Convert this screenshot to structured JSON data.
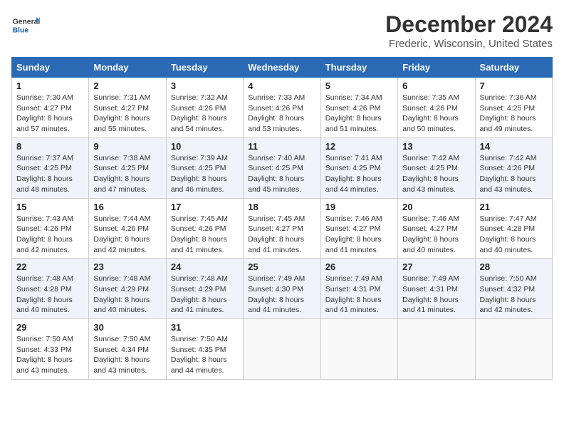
{
  "header": {
    "logo_general": "General",
    "logo_blue": "Blue",
    "title": "December 2024",
    "location": "Frederic, Wisconsin, United States"
  },
  "days_of_week": [
    "Sunday",
    "Monday",
    "Tuesday",
    "Wednesday",
    "Thursday",
    "Friday",
    "Saturday"
  ],
  "weeks": [
    [
      {
        "day": "1",
        "sunrise": "Sunrise: 7:30 AM",
        "sunset": "Sunset: 4:27 PM",
        "daylight": "Daylight: 8 hours and 57 minutes."
      },
      {
        "day": "2",
        "sunrise": "Sunrise: 7:31 AM",
        "sunset": "Sunset: 4:27 PM",
        "daylight": "Daylight: 8 hours and 55 minutes."
      },
      {
        "day": "3",
        "sunrise": "Sunrise: 7:32 AM",
        "sunset": "Sunset: 4:26 PM",
        "daylight": "Daylight: 8 hours and 54 minutes."
      },
      {
        "day": "4",
        "sunrise": "Sunrise: 7:33 AM",
        "sunset": "Sunset: 4:26 PM",
        "daylight": "Daylight: 8 hours and 53 minutes."
      },
      {
        "day": "5",
        "sunrise": "Sunrise: 7:34 AM",
        "sunset": "Sunset: 4:26 PM",
        "daylight": "Daylight: 8 hours and 51 minutes."
      },
      {
        "day": "6",
        "sunrise": "Sunrise: 7:35 AM",
        "sunset": "Sunset: 4:26 PM",
        "daylight": "Daylight: 8 hours and 50 minutes."
      },
      {
        "day": "7",
        "sunrise": "Sunrise: 7:36 AM",
        "sunset": "Sunset: 4:25 PM",
        "daylight": "Daylight: 8 hours and 49 minutes."
      }
    ],
    [
      {
        "day": "8",
        "sunrise": "Sunrise: 7:37 AM",
        "sunset": "Sunset: 4:25 PM",
        "daylight": "Daylight: 8 hours and 48 minutes."
      },
      {
        "day": "9",
        "sunrise": "Sunrise: 7:38 AM",
        "sunset": "Sunset: 4:25 PM",
        "daylight": "Daylight: 8 hours and 47 minutes."
      },
      {
        "day": "10",
        "sunrise": "Sunrise: 7:39 AM",
        "sunset": "Sunset: 4:25 PM",
        "daylight": "Daylight: 8 hours and 46 minutes."
      },
      {
        "day": "11",
        "sunrise": "Sunrise: 7:40 AM",
        "sunset": "Sunset: 4:25 PM",
        "daylight": "Daylight: 8 hours and 45 minutes."
      },
      {
        "day": "12",
        "sunrise": "Sunrise: 7:41 AM",
        "sunset": "Sunset: 4:25 PM",
        "daylight": "Daylight: 8 hours and 44 minutes."
      },
      {
        "day": "13",
        "sunrise": "Sunrise: 7:42 AM",
        "sunset": "Sunset: 4:25 PM",
        "daylight": "Daylight: 8 hours and 43 minutes."
      },
      {
        "day": "14",
        "sunrise": "Sunrise: 7:42 AM",
        "sunset": "Sunset: 4:26 PM",
        "daylight": "Daylight: 8 hours and 43 minutes."
      }
    ],
    [
      {
        "day": "15",
        "sunrise": "Sunrise: 7:43 AM",
        "sunset": "Sunset: 4:26 PM",
        "daylight": "Daylight: 8 hours and 42 minutes."
      },
      {
        "day": "16",
        "sunrise": "Sunrise: 7:44 AM",
        "sunset": "Sunset: 4:26 PM",
        "daylight": "Daylight: 8 hours and 42 minutes."
      },
      {
        "day": "17",
        "sunrise": "Sunrise: 7:45 AM",
        "sunset": "Sunset: 4:26 PM",
        "daylight": "Daylight: 8 hours and 41 minutes."
      },
      {
        "day": "18",
        "sunrise": "Sunrise: 7:45 AM",
        "sunset": "Sunset: 4:27 PM",
        "daylight": "Daylight: 8 hours and 41 minutes."
      },
      {
        "day": "19",
        "sunrise": "Sunrise: 7:46 AM",
        "sunset": "Sunset: 4:27 PM",
        "daylight": "Daylight: 8 hours and 41 minutes."
      },
      {
        "day": "20",
        "sunrise": "Sunrise: 7:46 AM",
        "sunset": "Sunset: 4:27 PM",
        "daylight": "Daylight: 8 hours and 40 minutes."
      },
      {
        "day": "21",
        "sunrise": "Sunrise: 7:47 AM",
        "sunset": "Sunset: 4:28 PM",
        "daylight": "Daylight: 8 hours and 40 minutes."
      }
    ],
    [
      {
        "day": "22",
        "sunrise": "Sunrise: 7:48 AM",
        "sunset": "Sunset: 4:28 PM",
        "daylight": "Daylight: 8 hours and 40 minutes."
      },
      {
        "day": "23",
        "sunrise": "Sunrise: 7:48 AM",
        "sunset": "Sunset: 4:29 PM",
        "daylight": "Daylight: 8 hours and 40 minutes."
      },
      {
        "day": "24",
        "sunrise": "Sunrise: 7:48 AM",
        "sunset": "Sunset: 4:29 PM",
        "daylight": "Daylight: 8 hours and 41 minutes."
      },
      {
        "day": "25",
        "sunrise": "Sunrise: 7:49 AM",
        "sunset": "Sunset: 4:30 PM",
        "daylight": "Daylight: 8 hours and 41 minutes."
      },
      {
        "day": "26",
        "sunrise": "Sunrise: 7:49 AM",
        "sunset": "Sunset: 4:31 PM",
        "daylight": "Daylight: 8 hours and 41 minutes."
      },
      {
        "day": "27",
        "sunrise": "Sunrise: 7:49 AM",
        "sunset": "Sunset: 4:31 PM",
        "daylight": "Daylight: 8 hours and 41 minutes."
      },
      {
        "day": "28",
        "sunrise": "Sunrise: 7:50 AM",
        "sunset": "Sunset: 4:32 PM",
        "daylight": "Daylight: 8 hours and 42 minutes."
      }
    ],
    [
      {
        "day": "29",
        "sunrise": "Sunrise: 7:50 AM",
        "sunset": "Sunset: 4:33 PM",
        "daylight": "Daylight: 8 hours and 43 minutes."
      },
      {
        "day": "30",
        "sunrise": "Sunrise: 7:50 AM",
        "sunset": "Sunset: 4:34 PM",
        "daylight": "Daylight: 8 hours and 43 minutes."
      },
      {
        "day": "31",
        "sunrise": "Sunrise: 7:50 AM",
        "sunset": "Sunset: 4:35 PM",
        "daylight": "Daylight: 8 hours and 44 minutes."
      },
      null,
      null,
      null,
      null
    ]
  ]
}
